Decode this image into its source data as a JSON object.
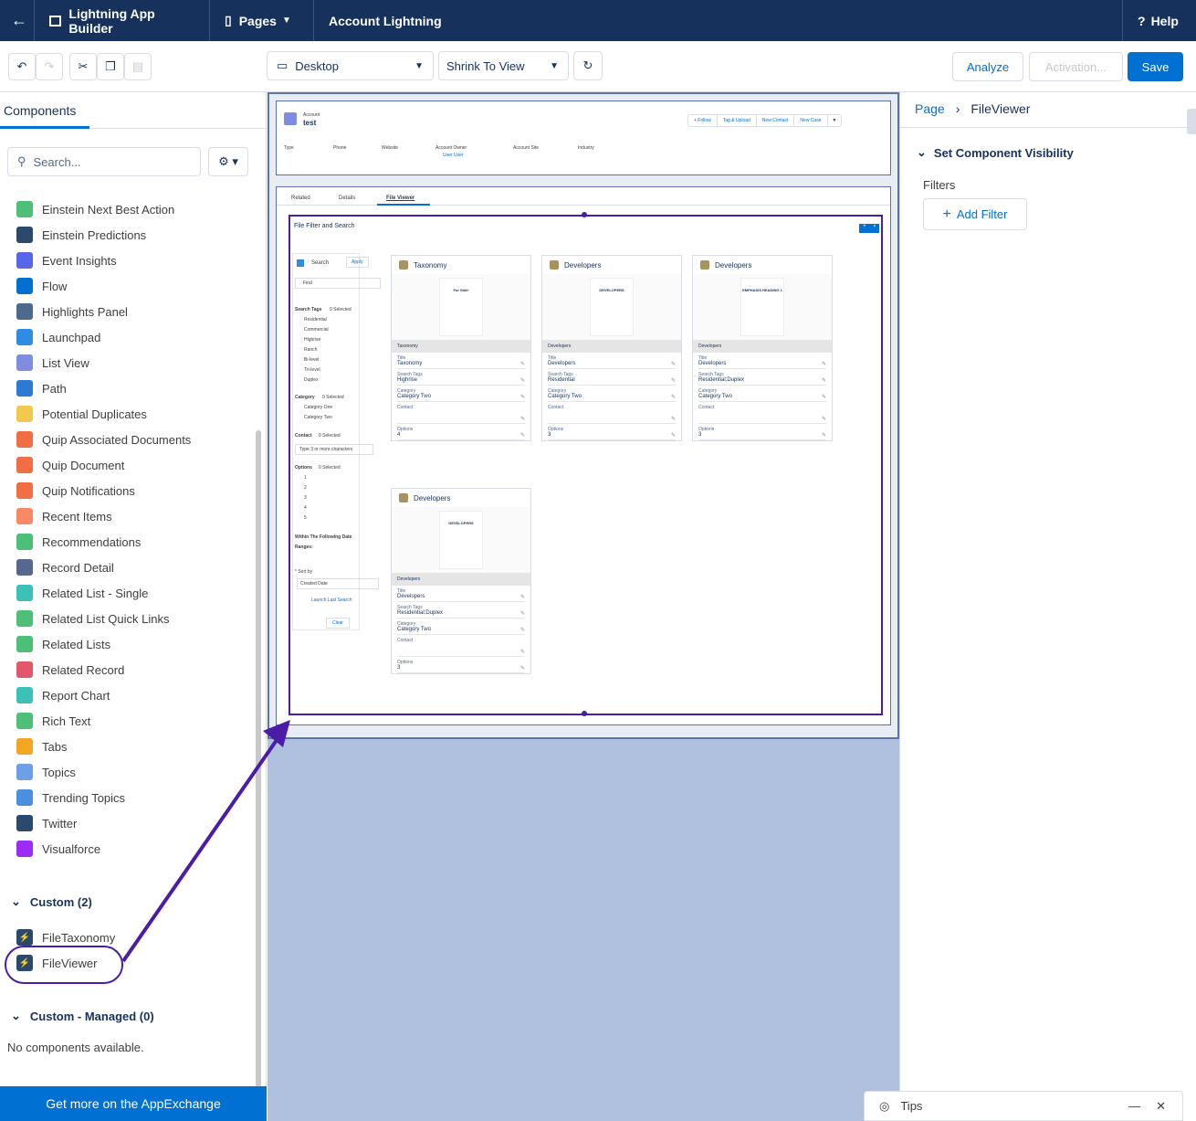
{
  "topbar": {
    "app_title": "Lightning App Builder",
    "pages_label": "Pages",
    "page_name": "Account Lightning",
    "help_label": "Help"
  },
  "toolbar": {
    "device": "Desktop",
    "view": "Shrink To View",
    "analyze": "Analyze",
    "activation": "Activation...",
    "save": "Save"
  },
  "left": {
    "tab": "Components",
    "search_placeholder": "Search...",
    "components": [
      {
        "label": "Einstein Next Best Action",
        "color": "#4bc076",
        "icon": "einstein-icon"
      },
      {
        "label": "Einstein Predictions",
        "color": "#2a4a6d",
        "icon": "einstein-predictions-icon"
      },
      {
        "label": "Event Insights",
        "color": "#5867e8",
        "icon": "event-insights-icon"
      },
      {
        "label": "Flow",
        "color": "#0070d2",
        "icon": "flow-icon"
      },
      {
        "label": "Highlights Panel",
        "color": "#4b6a8c",
        "icon": "highlights-panel-icon"
      },
      {
        "label": "Launchpad",
        "color": "#2f8ce4",
        "icon": "launchpad-icon"
      },
      {
        "label": "List View",
        "color": "#7f8de1",
        "icon": "list-view-icon"
      },
      {
        "label": "Path",
        "color": "#2a7ad6",
        "icon": "path-icon"
      },
      {
        "label": "Potential Duplicates",
        "color": "#f2c94c",
        "icon": "duplicates-icon"
      },
      {
        "label": "Quip Associated Documents",
        "color": "#f26c44",
        "icon": "quip-icon"
      },
      {
        "label": "Quip Document",
        "color": "#f26c44",
        "icon": "quip-icon"
      },
      {
        "label": "Quip Notifications",
        "color": "#f26c44",
        "icon": "quip-icon"
      },
      {
        "label": "Recent Items",
        "color": "#f88962",
        "icon": "clock-icon"
      },
      {
        "label": "Recommendations",
        "color": "#4bc076",
        "icon": "lightbulb-icon"
      },
      {
        "label": "Record Detail",
        "color": "#54698d",
        "icon": "record-detail-icon"
      },
      {
        "label": "Related List - Single",
        "color": "#3bc1b5",
        "icon": "related-list-icon"
      },
      {
        "label": "Related List Quick Links",
        "color": "#4bc076",
        "icon": "quick-links-icon"
      },
      {
        "label": "Related Lists",
        "color": "#4bc076",
        "icon": "related-lists-icon"
      },
      {
        "label": "Related Record",
        "color": "#e3576b",
        "icon": "related-record-icon"
      },
      {
        "label": "Report Chart",
        "color": "#3bc1b5",
        "icon": "report-chart-icon"
      },
      {
        "label": "Rich Text",
        "color": "#4bc076",
        "icon": "rich-text-icon"
      },
      {
        "label": "Tabs",
        "color": "#f4a623",
        "icon": "tabs-icon"
      },
      {
        "label": "Topics",
        "color": "#6c9fe6",
        "icon": "hashtag-icon"
      },
      {
        "label": "Trending Topics",
        "color": "#4a8fe2",
        "icon": "trending-icon"
      },
      {
        "label": "Twitter",
        "color": "#2a4a6d",
        "icon": "twitter-icon"
      },
      {
        "label": "Visualforce",
        "color": "#9a2cf5",
        "icon": "code-icon"
      }
    ],
    "custom_header": "Custom (2)",
    "custom": [
      {
        "label": "FileTaxonomy"
      },
      {
        "label": "FileViewer"
      }
    ],
    "managed_header": "Custom - Managed (0)",
    "no_components": "No components available.",
    "appexchange": "Get more on the AppExchange"
  },
  "canvas": {
    "record": {
      "object": "Account",
      "name": "test",
      "buttons": [
        "+ Follow",
        "Tag & Upload",
        "New Contact",
        "New Case"
      ],
      "fields": [
        "Type",
        "Phone",
        "Website",
        "Account Owner",
        "Account Site",
        "Industry"
      ],
      "owner": "User User"
    },
    "tabs": [
      "Related",
      "Details",
      "File Viewer"
    ],
    "component_title": "File Filter and Search",
    "filter": {
      "search": "Search",
      "apply": "Apply",
      "find": "Find",
      "tags_label": "Search Tags",
      "tags_count": "0 Selected",
      "tags": [
        "Residential",
        "Commercial",
        "Highrise",
        "Ranch",
        "Bi-level",
        "Tri-level",
        "Duplex"
      ],
      "category_label": "Category",
      "category_count": "0 Selected",
      "categories": [
        "Category One",
        "Category Two"
      ],
      "contact_label": "Contact",
      "contact_count": "0 Selected",
      "contact_placeholder": "Type 3 or more characters",
      "options_label": "Options",
      "options_count": "0 Selected",
      "options": [
        "1",
        "2",
        "3",
        "4",
        "5"
      ],
      "date_label": "Within The Following Date",
      "ranges": "Ranges:",
      "sort_label": "* Sort by",
      "sort_value": "Created Date",
      "launch": "Launch Last Search",
      "clear": "Clear"
    },
    "cards": [
      {
        "title": "Taxonomy",
        "file": "Taxonomy",
        "doc_heading": "For Sale!",
        "title_val": "Taxonomy",
        "tags": "Highrise",
        "category": "Category Two",
        "options": "4"
      },
      {
        "title": "Developers",
        "file": "Developers",
        "doc_heading": "DEVELOPERS",
        "title_val": "Developers",
        "tags": "Residential",
        "category": "Category Two",
        "options": "3"
      },
      {
        "title": "Developers",
        "file": "Developers",
        "doc_heading": "EMPHASIS HEADING 1",
        "title_val": "Developers",
        "tags": "Residential;Duplex",
        "category": "Category Two",
        "options": "3"
      },
      {
        "title": "Developers",
        "file": "Developers",
        "doc_heading": "DEVELOPERS",
        "title_val": "Developers",
        "tags": "Residential;Duplex",
        "category": "Category Two",
        "options": "3"
      }
    ],
    "field_labels": {
      "title": "Title",
      "tags": "Search Tags",
      "category": "Category",
      "contact": "Contact",
      "options": "Options"
    }
  },
  "right": {
    "crumb_page": "Page",
    "crumb_component": "FileViewer",
    "section": "Set Component Visibility",
    "filters": "Filters",
    "add_filter": "Add Filter"
  },
  "tips": {
    "label": "Tips"
  },
  "colors": {
    "nav": "#16325c",
    "brand": "#0070d2",
    "highlight": "#4a1ca8",
    "canvas": "#b0c1df"
  }
}
